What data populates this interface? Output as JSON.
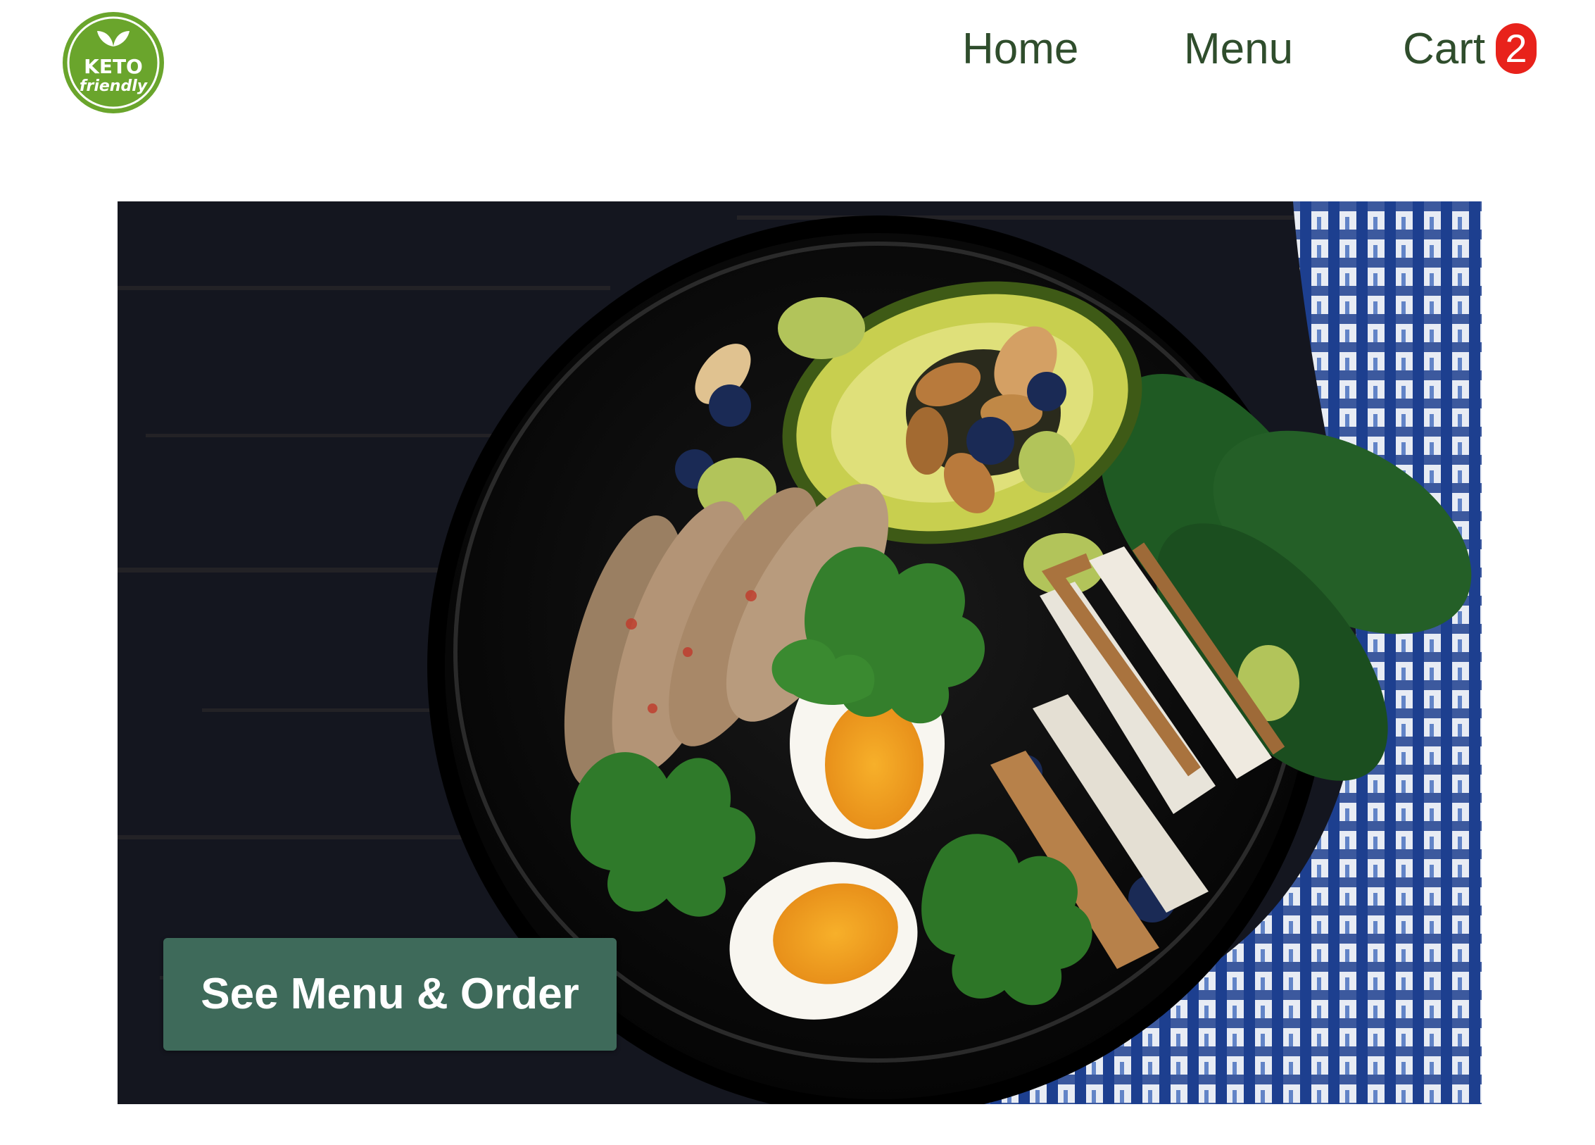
{
  "logo": {
    "line1": "KETO",
    "line2": "friendly",
    "color": "#6aa52c"
  },
  "nav": {
    "home_label": "Home",
    "menu_label": "Menu",
    "cart_label": "Cart",
    "cart_count": "2",
    "text_color": "#2f4d2c",
    "badge_color": "#e8221b"
  },
  "hero": {
    "cta_label": "See Menu & Order",
    "cta_color": "#3e6a5a"
  }
}
